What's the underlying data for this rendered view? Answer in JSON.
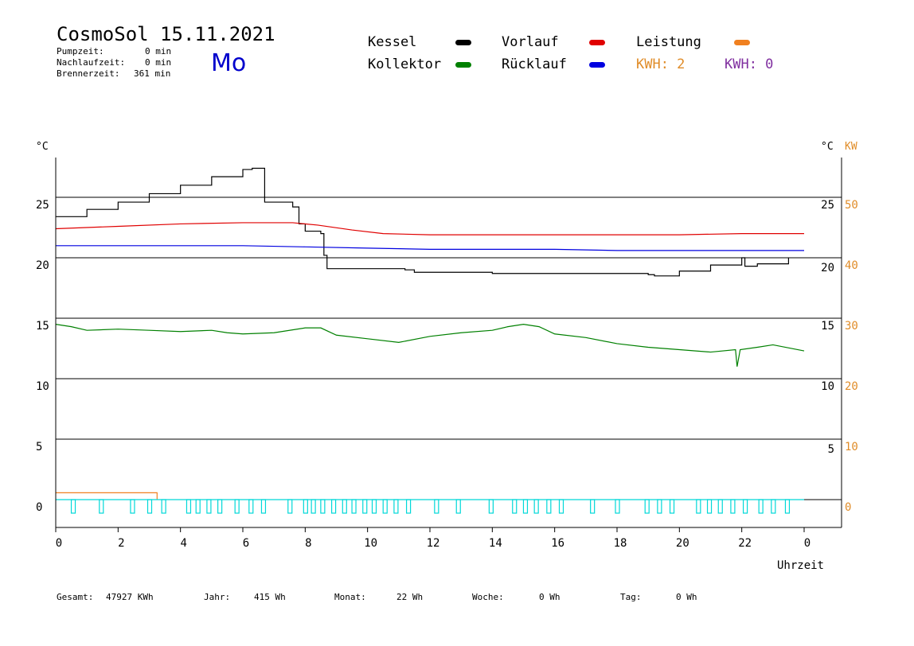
{
  "header": {
    "title": "CosmoSol 15.11.2021",
    "pump_label": "Pumpzeit:",
    "pump_value": "0 min",
    "overrun_label": "Nachlaufzeit:",
    "overrun_value": "0 min",
    "burner_label": "Brennerzeit:",
    "burner_value": "361 min",
    "weekday": "Mo"
  },
  "legend": {
    "kessel": "Kessel",
    "vorlauf": "Vorlauf",
    "leistung": "Leistung",
    "kollektor": "Kollektor",
    "ruecklauf": "Rücklauf",
    "kwh1": "KWH: 2",
    "kwh2": "KWH: 0"
  },
  "colors": {
    "kessel": "#000000",
    "vorlauf": "#e00000",
    "leistung": "#f08020",
    "kollektor": "#008000",
    "ruecklauf": "#0000e0",
    "pump": "#00d8d8",
    "kwh1": "#e08c28",
    "kwh2": "#8030a0"
  },
  "footer": {
    "gesamt_label": "Gesamt:",
    "gesamt_value": "47927 KWh",
    "jahr_label": "Jahr:",
    "jahr_value": "415 Wh",
    "monat_label": "Monat:",
    "monat_value": "22 Wh",
    "woche_label": "Woche:",
    "woche_value": "0 Wh",
    "tag_label": "Tag:",
    "tag_value": "0 Wh"
  },
  "chart_data": {
    "type": "line",
    "xlabel": "Uhrzeit",
    "x_tick_labels": [
      "0",
      "2",
      "4",
      "6",
      "8",
      "10",
      "12",
      "14",
      "16",
      "18",
      "20",
      "22",
      "0"
    ],
    "x_range": [
      0,
      24
    ],
    "y_left_label": "°C",
    "y_left_ticks": [
      "0",
      "5",
      "10",
      "15",
      "20",
      "25"
    ],
    "y_left_range": [
      -2,
      30
    ],
    "y_right_temp_label": "°C",
    "y_right_temp_ticks": [
      "5",
      "10",
      "15",
      "20",
      "25"
    ],
    "y_right_kw_label": "KW",
    "y_right_kw_ticks": [
      "0",
      "10",
      "20",
      "30",
      "40",
      "50"
    ],
    "grid_y": [
      0,
      5,
      10,
      15,
      20,
      25
    ],
    "series": [
      {
        "name": "Kessel",
        "color": "#000000",
        "step": true,
        "points": [
          [
            0,
            23.4
          ],
          [
            1,
            24.0
          ],
          [
            2,
            24.6
          ],
          [
            3,
            25.3
          ],
          [
            4,
            26.0
          ],
          [
            5,
            26.7
          ],
          [
            6,
            27.3
          ],
          [
            6.3,
            27.4
          ],
          [
            6.6,
            27.4
          ],
          [
            6.7,
            24.6
          ],
          [
            7.4,
            24.6
          ],
          [
            7.6,
            24.2
          ],
          [
            7.8,
            22.8
          ],
          [
            8.0,
            22.2
          ],
          [
            8.5,
            22.0
          ],
          [
            8.6,
            20.2
          ],
          [
            8.7,
            19.1
          ],
          [
            11.2,
            19.0
          ],
          [
            11.5,
            18.8
          ],
          [
            14.0,
            18.7
          ],
          [
            19.0,
            18.6
          ],
          [
            19.2,
            18.5
          ],
          [
            20,
            18.9
          ],
          [
            21,
            19.4
          ],
          [
            22.0,
            20.0
          ],
          [
            22.1,
            19.3
          ],
          [
            22.5,
            19.5
          ],
          [
            23.5,
            20.0
          ]
        ]
      },
      {
        "name": "Vorlauf",
        "color": "#e00000",
        "points": [
          [
            0,
            22.4
          ],
          [
            2,
            22.6
          ],
          [
            4,
            22.8
          ],
          [
            6,
            22.9
          ],
          [
            7.6,
            22.9
          ],
          [
            8.4,
            22.7
          ],
          [
            9.5,
            22.3
          ],
          [
            10.5,
            22.0
          ],
          [
            12,
            21.9
          ],
          [
            14,
            21.9
          ],
          [
            16,
            21.9
          ],
          [
            18,
            21.9
          ],
          [
            20,
            21.9
          ],
          [
            22,
            22.0
          ],
          [
            24,
            22.0
          ]
        ]
      },
      {
        "name": "Rücklauf",
        "color": "#0000e0",
        "points": [
          [
            0,
            21.0
          ],
          [
            2,
            21.0
          ],
          [
            4,
            21.0
          ],
          [
            6,
            21.0
          ],
          [
            8,
            20.9
          ],
          [
            10,
            20.8
          ],
          [
            12,
            20.7
          ],
          [
            14,
            20.7
          ],
          [
            16,
            20.7
          ],
          [
            18,
            20.6
          ],
          [
            20,
            20.6
          ],
          [
            22,
            20.6
          ],
          [
            24,
            20.6
          ]
        ]
      },
      {
        "name": "Kollektor",
        "color": "#008000",
        "points": [
          [
            0,
            14.5
          ],
          [
            0.5,
            14.3
          ],
          [
            1,
            14.0
          ],
          [
            2,
            14.1
          ],
          [
            3,
            14.0
          ],
          [
            4,
            13.9
          ],
          [
            5,
            14.0
          ],
          [
            5.5,
            13.8
          ],
          [
            6,
            13.7
          ],
          [
            7,
            13.8
          ],
          [
            8,
            14.2
          ],
          [
            8.5,
            14.2
          ],
          [
            9,
            13.6
          ],
          [
            10,
            13.3
          ],
          [
            11,
            13.0
          ],
          [
            12,
            13.5
          ],
          [
            13,
            13.8
          ],
          [
            14,
            14.0
          ],
          [
            14.5,
            14.3
          ],
          [
            15,
            14.5
          ],
          [
            15.5,
            14.3
          ],
          [
            16,
            13.7
          ],
          [
            17,
            13.4
          ],
          [
            18,
            12.9
          ],
          [
            19,
            12.6
          ],
          [
            20,
            12.4
          ],
          [
            21,
            12.2
          ],
          [
            21.8,
            12.4
          ],
          [
            21.85,
            11.0
          ],
          [
            21.95,
            12.4
          ],
          [
            22.5,
            12.6
          ],
          [
            23,
            12.8
          ],
          [
            24,
            12.3
          ]
        ]
      }
    ],
    "leistung": {
      "name": "Leistung",
      "color": "#f08020",
      "x_range": [
        0,
        3.25
      ],
      "kw": 1
    }
  }
}
